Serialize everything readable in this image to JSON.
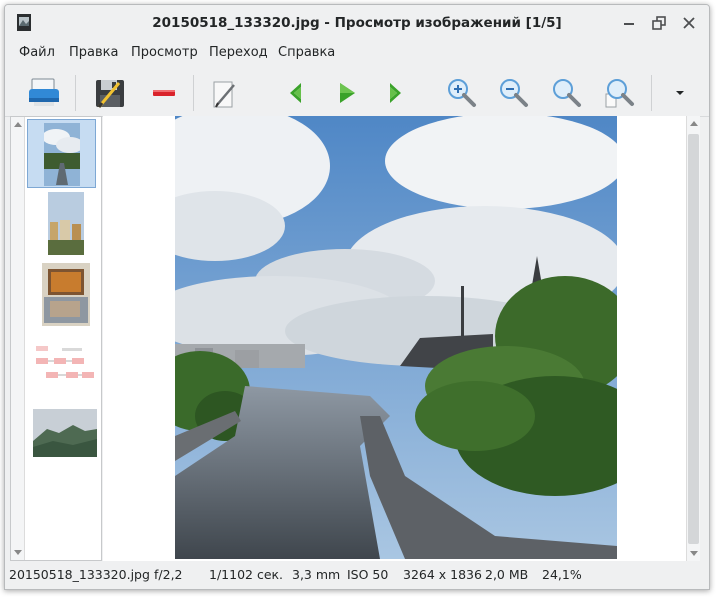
{
  "window": {
    "title": "20150518_133320.jpg - Просмотр изображений [1/5]",
    "controls": [
      "minimize",
      "maximize",
      "close"
    ]
  },
  "menu": {
    "items": [
      "Файл",
      "Правка",
      "Просмотр",
      "Переход",
      "Справка"
    ]
  },
  "toolbar": {
    "buttons": [
      {
        "icon": "print-icon"
      },
      {
        "icon": "save-as-icon"
      },
      {
        "icon": "delete-icon"
      },
      {
        "icon": "edit-icon"
      },
      {
        "icon": "previous-icon"
      },
      {
        "icon": "slideshow-play-icon"
      },
      {
        "icon": "next-icon"
      },
      {
        "icon": "zoom-in-icon"
      },
      {
        "icon": "zoom-out-icon"
      },
      {
        "icon": "zoom-original-icon"
      },
      {
        "icon": "zoom-fit-icon"
      },
      {
        "icon": "more-dropdown-icon"
      }
    ],
    "accent_colors": {
      "nav_green": "#3aa22a",
      "delete_red": "#d9232b",
      "print_blue": "#3189d6"
    }
  },
  "thumbnails": {
    "count": 5,
    "selected_index": 0,
    "items": [
      "river-photo",
      "city-photo",
      "painting-photo",
      "flowchart-document",
      "mountains-photo"
    ]
  },
  "status": {
    "filename": "20150518_133320.jpg",
    "aperture": "f/2,2",
    "exposure": "1/1102 сек.",
    "focal_length": "3,3 mm",
    "iso": "ISO 50",
    "dimensions": "3264 x 1836",
    "filesize": "2,0 MB",
    "zoom": "24,1%"
  }
}
